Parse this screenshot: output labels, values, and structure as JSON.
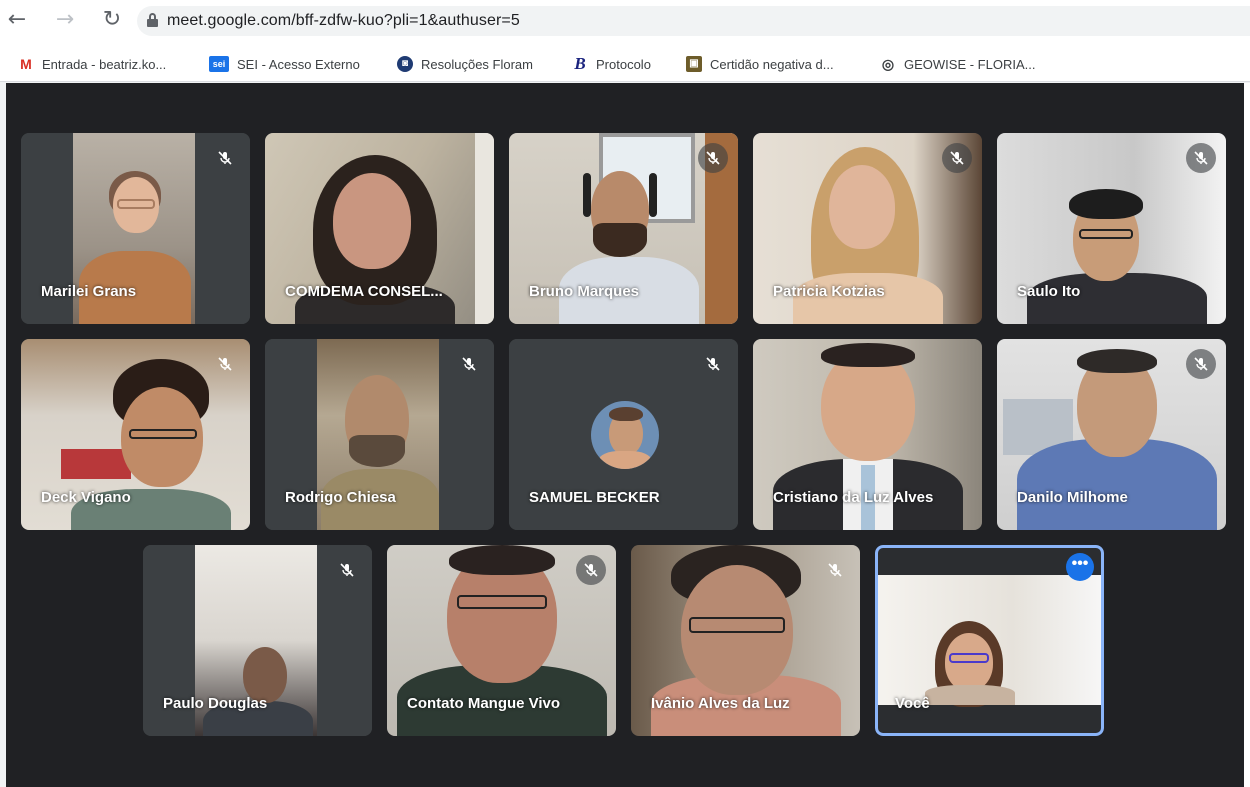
{
  "browser": {
    "url": "meet.google.com/bff-zdfw-kuo?pli=1&authuser=5",
    "bookmarks": [
      {
        "label": "Entrada - beatriz.ko...",
        "icon": "gmail-icon",
        "color": "#d93025",
        "glyph": "M"
      },
      {
        "label": "SEI - Acesso Externo",
        "icon": "sei-icon",
        "color": "#1a73e8",
        "glyph": "sei"
      },
      {
        "label": "Resoluções Floram",
        "icon": "floram-icon",
        "color": "#1f3b73",
        "glyph": "◙"
      },
      {
        "label": "Protocolo",
        "icon": "protocolo-icon",
        "color": "#1a237e",
        "glyph": "B"
      },
      {
        "label": "Certidão negativa d...",
        "icon": "certidao-icon",
        "color": "#6d5c2a",
        "glyph": "▣"
      },
      {
        "label": "GEOWISE - FLORIA...",
        "icon": "geowise-icon",
        "color": "#3c4043",
        "glyph": "◎"
      }
    ]
  },
  "meet": {
    "participants": [
      {
        "name": "Marilei Grans",
        "muted": true
      },
      {
        "name": "COMDEMA CONSEL...",
        "muted": false
      },
      {
        "name": "Bruno Marques",
        "muted": true
      },
      {
        "name": "Patricia Kotzias",
        "muted": true
      },
      {
        "name": "Saulo Ito",
        "muted": true
      },
      {
        "name": "Deck Vigano",
        "muted": true
      },
      {
        "name": "Rodrigo Chiesa",
        "muted": true
      },
      {
        "name": "SAMUEL BECKER",
        "muted": true
      },
      {
        "name": "Cristiano da Luz Alves",
        "muted": false
      },
      {
        "name": "Danilo Milhome",
        "muted": true
      },
      {
        "name": "Paulo Douglas",
        "muted": true
      },
      {
        "name": "Contato Mangue Vivo",
        "muted": true
      },
      {
        "name": "Ivânio Alves da Luz",
        "muted": true
      },
      {
        "name": "Você",
        "muted": false,
        "self": true
      }
    ],
    "more_options_label": "•••",
    "colors": {
      "stage": "#202124",
      "tile": "#3c4043",
      "accent": "#8ab4f8",
      "button": "#1a73e8"
    }
  }
}
